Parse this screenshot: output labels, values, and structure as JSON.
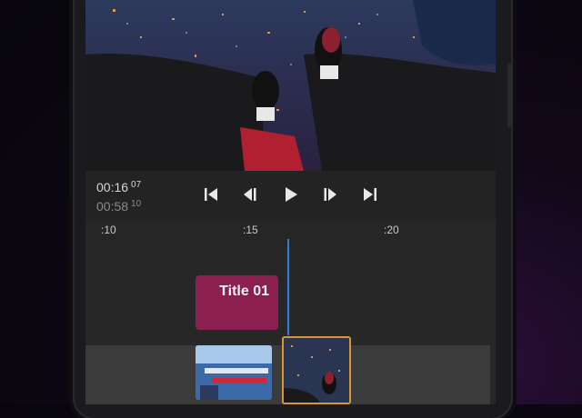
{
  "playback": {
    "current_time": "00:16",
    "current_frames": "07",
    "total_time": "00:58",
    "total_frames": "10"
  },
  "transport": {
    "icons": [
      "skip-to-start-icon",
      "step-back-icon",
      "play-icon",
      "step-forward-icon",
      "skip-to-end-icon"
    ]
  },
  "ruler": {
    "ticks": [
      ":10",
      ":15",
      ":20"
    ]
  },
  "timeline": {
    "title_clip_label": "Title 01"
  },
  "colors": {
    "title_clip": "#8b1f4f",
    "playhead": "#2d7fd9",
    "selected_clip_border": "#d99632",
    "panel_bg": "#262626"
  }
}
